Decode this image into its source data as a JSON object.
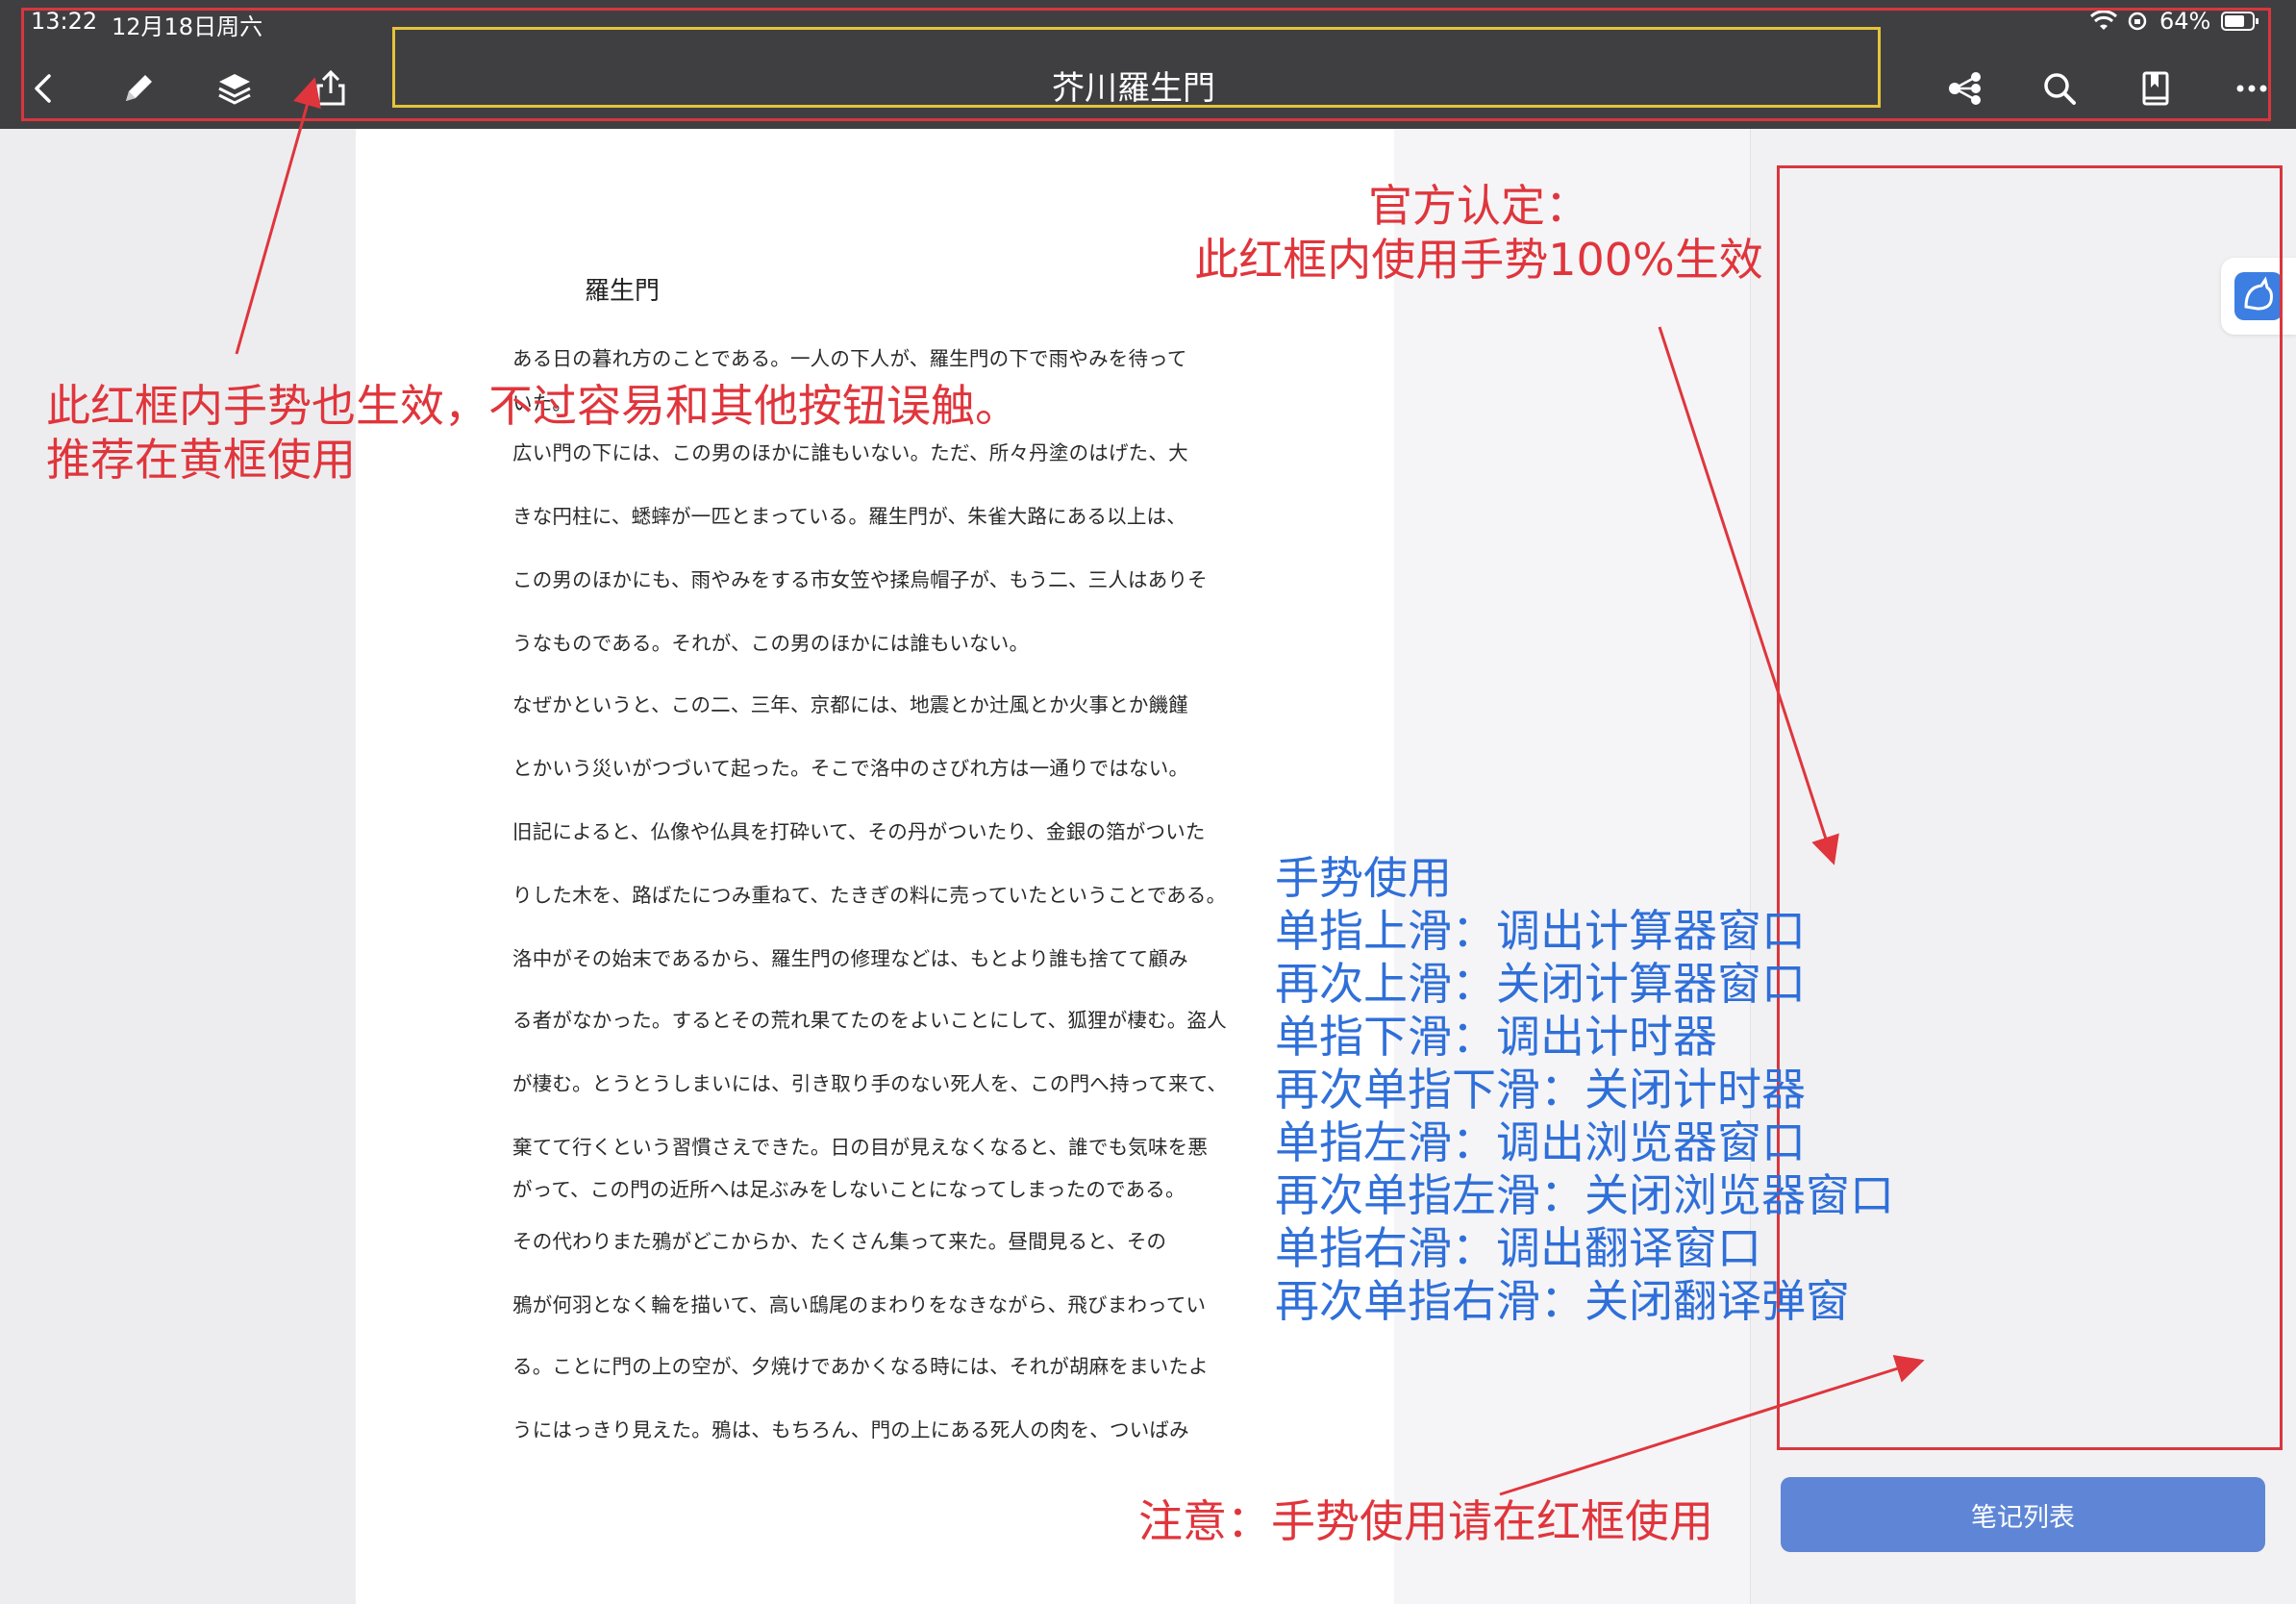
{
  "status_bar": {
    "time": "13:22",
    "date": "12月18日周六",
    "battery": "64%"
  },
  "toolbar": {
    "title": "芥川羅生門",
    "icons": [
      "back-icon",
      "pencil-icon",
      "layers-icon",
      "share-icon",
      "mind-map-icon",
      "search-icon",
      "bookmark-icon",
      "more-icon"
    ]
  },
  "document": {
    "title": "羅生門",
    "lines": [
      "ある日の暮れ方のことである。一人の下人が、羅生門の下で雨やみを待って",
      "いた。",
      "広い門の下には、この男のほかに誰もいない。ただ、所々丹塗のはげた、大",
      "きな円柱に、蟋蟀が一匹とまっている。羅生門が、朱雀大路にある以上は、",
      "この男のほかにも、雨やみをする市女笠や揉烏帽子が、もう二、三人はありそ",
      "うなものである。それが、この男のほかには誰もいない。",
      "なぜかというと、この二、三年、京都には、地震とか辻風とか火事とか饑饉",
      "とかいう災いがつづいて起った。そこで洛中のさびれ方は一通りではない。",
      "旧記によると、仏像や仏具を打砕いて、その丹がついたり、金銀の箔がついた",
      "りした木を、路ばたにつみ重ねて、たきぎの料に売っていたということである。",
      "洛中がその始末であるから、羅生門の修理などは、もとより誰も捨てて顧み",
      "る者がなかった。するとその荒れ果てたのをよいことにして、狐狸が棲む。盗人",
      "が棲む。とうとうしまいには、引き取り手のない死人を、この門へ持って来て、",
      "棄てて行くという習慣さえできた。日の目が見えなくなると、誰でも気味を悪",
      "がって、この門の近所へは足ぶみをしないことになってしまったのである。",
      "その代わりまた鴉がどこからか、たくさん集って来た。昼間見ると、その",
      "鴉が何羽となく輪を描いて、高い鴟尾のまわりをなきながら、飛びまわってい",
      "る。ことに門の上の空が、夕焼けであかくなる時には、それが胡麻をまいたよ",
      "うにはっきり見えた。鴉は、もちろん、門の上にある死人の肉を、ついばみ"
    ]
  },
  "annotations": {
    "toolbar_note_line1": "此红框内手势也生效，不过容易和其他按钮误触。",
    "toolbar_note_line2": "推荐在黄框使用",
    "official_line1": "官方认定：",
    "official_line2": "此红框内使用手势100%生效",
    "gesture_title": "手势使用",
    "gestures": [
      "单指上滑：调出计算器窗口",
      "再次上滑：关闭计算器窗口",
      "单指下滑：调出计时器",
      "再次单指下滑：关闭计时器",
      "单指左滑：调出浏览器窗口",
      "再次单指左滑：关闭浏览器窗口",
      "单指右滑：调出翻译窗口",
      "再次单指右滑：关闭翻译弹窗"
    ],
    "bottom_note": "注意：手势使用请在红框使用"
  },
  "sidebar": {
    "notes_button": "笔记列表"
  },
  "colors": {
    "annotation_red": "#e0353c",
    "annotation_blue": "#2f6fd9",
    "highlight_yellow": "#e6c33a",
    "toolbar_bg": "#3f3f42",
    "notes_button": "#5f86d6"
  }
}
